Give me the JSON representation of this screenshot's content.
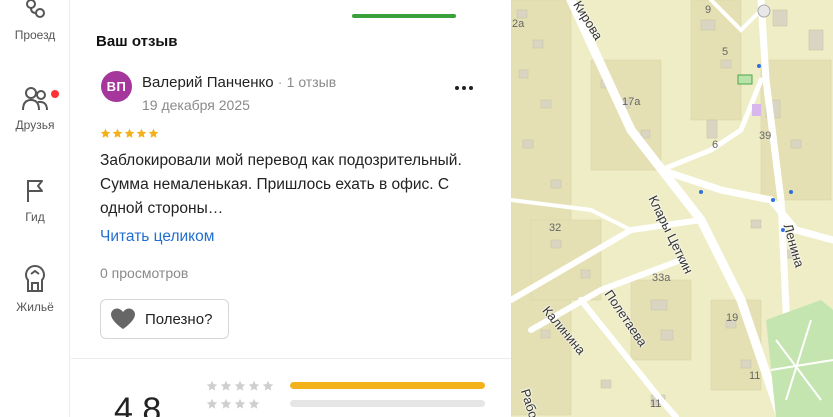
{
  "rail": {
    "items": [
      {
        "label": "Проезд",
        "icon": "route-icon"
      },
      {
        "label": "Друзья",
        "icon": "friends-icon",
        "has_notification": true
      },
      {
        "label": "Гид",
        "icon": "flag-icon"
      },
      {
        "label": "Жильё",
        "icon": "housing-icon"
      }
    ]
  },
  "review": {
    "section_title": "Ваш отзыв",
    "avatar_initials": "ВП",
    "avatar_color": "#a5369c",
    "author": "Валерий Панченко",
    "separator": "·",
    "review_count": "1 отзыв",
    "date": "19 декабря 2025",
    "stars": 5,
    "text": "Заблокировали мой перевод как подозрительный. Сумма немаленькая. Пришлось ехать в офис. С одной стороны…",
    "read_more": "Читать целиком",
    "views": "0 просмотров",
    "useful_label": "Полезно?"
  },
  "summary": {
    "rating": "4,8",
    "rows": [
      {
        "stars": 5,
        "fraction": 1.0
      },
      {
        "stars": 4,
        "fraction": 0.0
      }
    ]
  },
  "map": {
    "streets": [
      "Кирова",
      "Клары Цеткин",
      "Ленина",
      "Полетаева",
      "Калинина",
      "Рабо"
    ],
    "houses": [
      "9",
      "5",
      "17а",
      "39",
      "6",
      "32",
      "33а",
      "19",
      "11",
      "11",
      "2а"
    ]
  },
  "colors": {
    "accent_green": "#3aa13a",
    "link_blue": "#1f6fd1",
    "star_yellow": "#f4b21a"
  }
}
